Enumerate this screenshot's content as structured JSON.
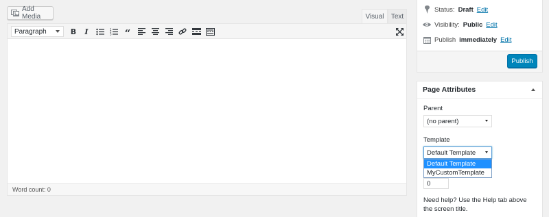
{
  "editor": {
    "add_media_label": "Add Media",
    "tabs": {
      "visual": "Visual",
      "text": "Text"
    },
    "format_select_value": "Paragraph",
    "word_count": "Word count: 0"
  },
  "publish": {
    "status_label": "Status:",
    "status_value": "Draft",
    "visibility_label": "Visibility:",
    "visibility_value": "Public",
    "publish_label": "Publish",
    "publish_value": "immediately",
    "edit_link": "Edit",
    "publish_button": "Publish"
  },
  "page_attributes": {
    "title": "Page Attributes",
    "parent_label": "Parent",
    "parent_value": "(no parent)",
    "template_label": "Template",
    "template_value": "Default Template",
    "template_options": [
      "Default Template",
      "MyCustomTemplate"
    ],
    "order_value": "0",
    "help_text": "Need help? Use the Help tab above the screen title."
  },
  "colors": {
    "accent": "#0085ba",
    "link": "#0073aa",
    "selected_option": "#1e90ff"
  }
}
